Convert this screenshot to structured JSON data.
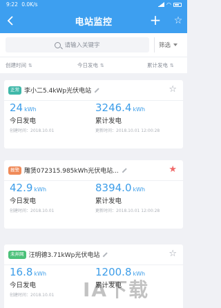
{
  "status_bar": {
    "time": "9:22",
    "speed": "0.0K/s"
  },
  "header": {
    "back_icon": "back-arrow-icon",
    "title": "电站监控",
    "add_label": "+",
    "star_icon": "star-outline-icon"
  },
  "search": {
    "placeholder": "请输入关键字",
    "filter_label": "筛选"
  },
  "sort": {
    "col1": "创建时间",
    "col2": "今日发电",
    "col3": "累计发电",
    "arrow": "⇅"
  },
  "stations": [
    {
      "badge": "正常",
      "badge_color": "#3fb8a9",
      "name": "李小二5.4kWp光伏电站",
      "starred": false,
      "star": "☆",
      "today_value": "24",
      "today_unit": "kWh",
      "today_label": "今日发电",
      "today_date": "创建时间：2018.10.01",
      "total_value": "3246.4",
      "total_unit": "kWh",
      "total_label": "累计发电",
      "total_date": "更新时间：2018.10.01 12:00:28"
    },
    {
      "badge": "报警",
      "badge_color": "#f08a58",
      "name": "雕赁072315.985kWh光伏电站...",
      "starred": true,
      "star": "★",
      "today_value": "42.9",
      "today_unit": "kWh",
      "today_label": "今日发电",
      "today_date": "创建时间：2018.10.01",
      "total_value": "8394.0",
      "total_unit": "kWh",
      "total_label": "累计发电",
      "total_date": "更新时间：2018.10.01 12:00:28"
    },
    {
      "badge": "未并网",
      "badge_color": "#4cc17a",
      "name": "汪明德3.71kWp光伏电站",
      "starred": false,
      "star": "☆",
      "today_value": "16.8",
      "today_unit": "kWh",
      "today_label": "今日发电",
      "today_date": "创建时间：2018.10.01",
      "total_value": "1200.8",
      "total_unit": "kWh",
      "total_label": "累计发电",
      "total_date": ""
    }
  ],
  "watermark": "IA下载"
}
